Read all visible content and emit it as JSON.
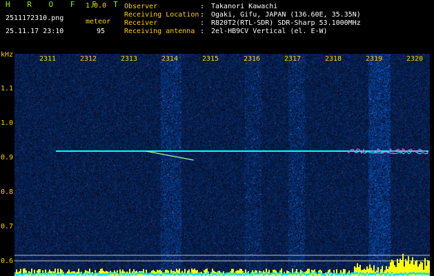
{
  "header": {
    "app_title": "H R O F F T",
    "app_version": "1.0.0",
    "file_name": "2511172310.png",
    "timestamp": "25.11.17 23:10",
    "event_type": "meteor",
    "event_count": "95"
  },
  "station": [
    {
      "label": "Observer",
      "value": "Takanori Kawachi"
    },
    {
      "label": "Receiving Location",
      "value": "Ogaki, Gifu, JAPAN (136.60E, 35.35N)"
    },
    {
      "label": "Receiver",
      "value": "R820T2(RTL-SDR) SDR-Sharp 53.1000MHz"
    },
    {
      "label": "Receiving antenna",
      "value": "2el-HB9CV Vertical (el. E-W)"
    }
  ],
  "colors": {
    "background": "#000000",
    "label_green": "#7cfc00",
    "label_yellow": "#ffd200",
    "noise_blue": "#1a1a8c",
    "carrier_cyan": "#00ffff",
    "histogram_yellow": "#ffff00",
    "histogram_cyan": "#00e0ff"
  },
  "chart_data": {
    "type": "heatmap",
    "ylabel": "kHz",
    "x_ticks": [
      "2311",
      "2312",
      "2313",
      "2314",
      "2315",
      "2316",
      "2317",
      "2318",
      "2319",
      "2320"
    ],
    "y_ticks": [
      "1.1",
      "1.0",
      "0.9",
      "0.8",
      "0.7",
      "0.6"
    ],
    "ylim": [
      0.6,
      1.15
    ],
    "grid": false,
    "carrier": {
      "freq_khz": 0.92,
      "start_minute": "2311"
    },
    "echo": {
      "start_minute": "2314",
      "end_minute": "2315",
      "freq_start_khz": 0.92,
      "freq_end_khz": 0.9
    },
    "activity": {
      "start_minute": "2318",
      "end_minute": "2320",
      "freq_khz": 0.92
    }
  }
}
